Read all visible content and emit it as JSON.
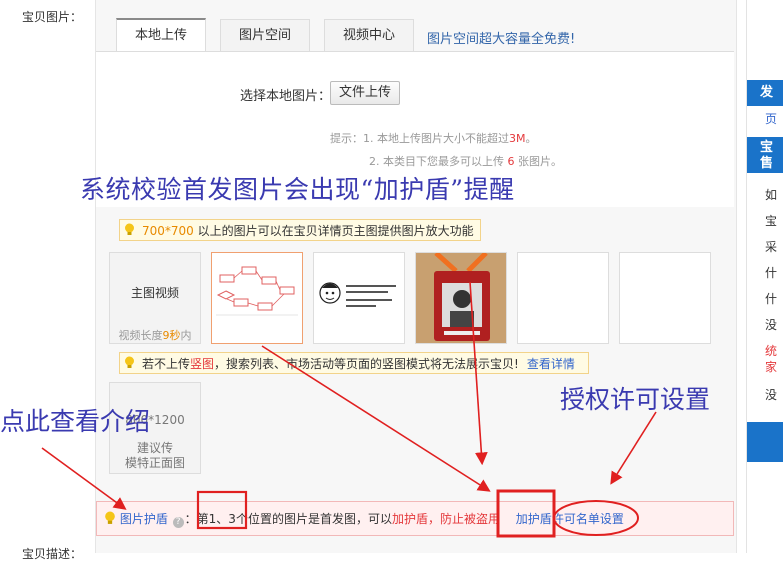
{
  "form": {
    "images_label": "宝贝图片：",
    "desc_label": "宝贝描述："
  },
  "tabs": [
    {
      "label": "本地上传",
      "active": true
    },
    {
      "label": "图片空间",
      "active": false
    },
    {
      "label": "视频中心",
      "active": false
    }
  ],
  "promo_text": "图片空间超大容量全免费!",
  "upload": {
    "select_label": "选择本地图片：",
    "button_label": "文件上传"
  },
  "hints": {
    "prefix": "提示：",
    "line1_a": "1.  本地上传图片大小不能超过",
    "line1_size": "3M",
    "line1_b": "。",
    "line2_a": "2.  本类目下您最多可以上传 ",
    "line2_count": "6",
    "line2_b": " 张图片。"
  },
  "annotations": {
    "main_caption": "系统校验首发图片会出现“加护盾”提醒",
    "auth_caption": "授权许可设置",
    "click_caption": "点此查看介绍"
  },
  "tip_zoom": {
    "size": "700*700",
    "text": " 以上的图片可以在宝贝详情页主图提供图片放大功能"
  },
  "video_slot": {
    "title": "主图视频",
    "sub_a": "视频长度",
    "sub_num": "9秒",
    "sub_b": "内"
  },
  "tip_vertical": {
    "a": "若不上传",
    "link": "竖图",
    "b": "，搜索列表、市场活动等页面的竖图模式将无法展示宝贝!",
    "detail": "查看详情"
  },
  "suggest_slot": {
    "size": "800*1200",
    "line1": "建议传",
    "line2": "模特正面图"
  },
  "shield": {
    "title": "图片护盾",
    "q": "?",
    "text_a": "：第1、3个位置的图片是首发图，可以",
    "text_red": "加护盾，防止被盗用",
    "btn_add": "加护盾",
    "btn_whitelist": "许可名单设置"
  },
  "right_strip": {
    "top_label": "发",
    "link": "页",
    "box_label_1": "宝",
    "box_label_2": "售",
    "items": [
      "如",
      "宝",
      "采",
      "什",
      "什",
      "没"
    ],
    "red_1": "统",
    "red_2": "家",
    "last": "没"
  },
  "colors": {
    "accent_blue": "#3366cc",
    "alert_red": "#e4393c",
    "annotation_red": "#e02020",
    "annotation_text": "#3a3ab0"
  }
}
